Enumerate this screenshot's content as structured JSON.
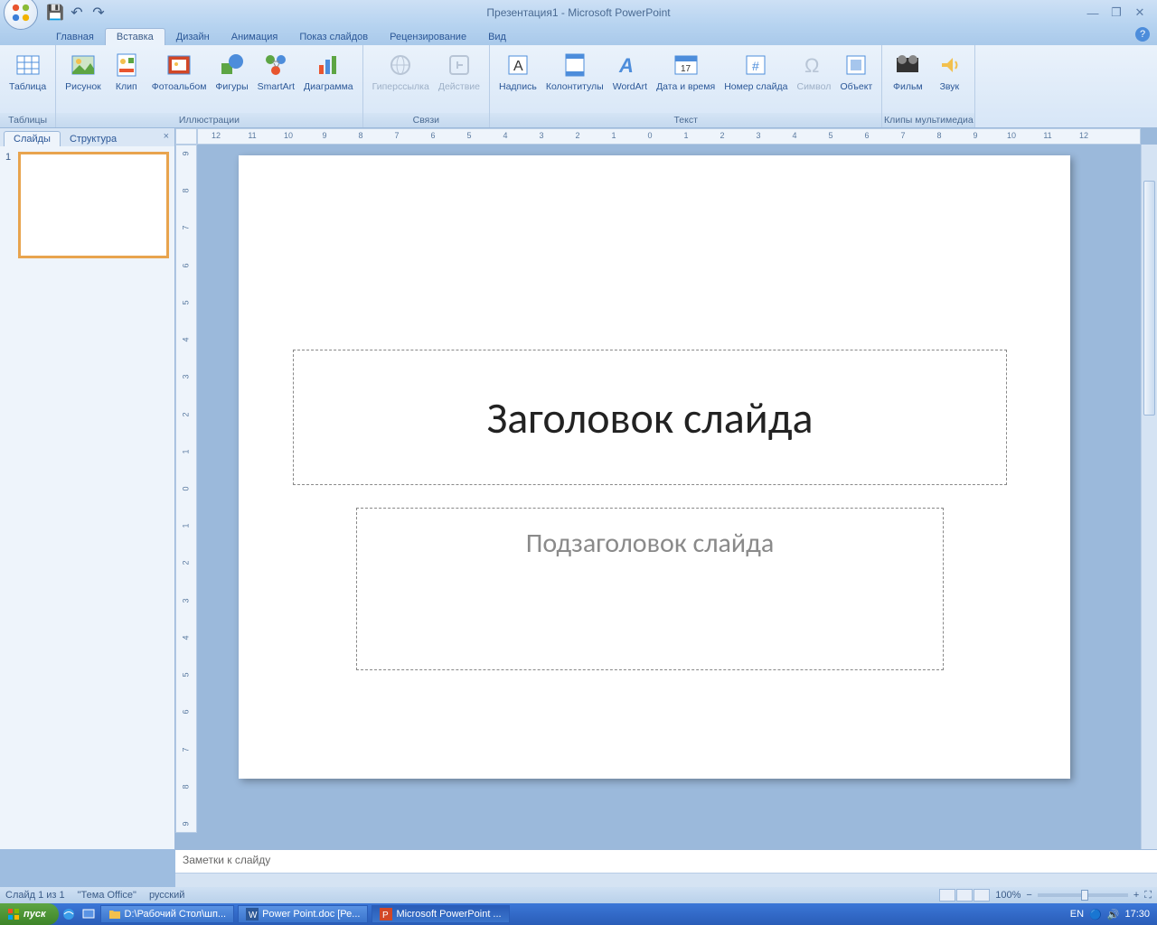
{
  "title": "Презентация1 - Microsoft PowerPoint",
  "qat": {
    "save": "💾",
    "undo": "↶",
    "redo": "↷"
  },
  "win": {
    "min": "—",
    "max": "❐",
    "close": "✕"
  },
  "tabs": [
    "Главная",
    "Вставка",
    "Дизайн",
    "Анимация",
    "Показ слайдов",
    "Рецензирование",
    "Вид"
  ],
  "active_tab": 1,
  "ribbon": {
    "groups": [
      {
        "label": "Таблицы",
        "items": [
          {
            "name": "Таблица",
            "icon": "table"
          }
        ]
      },
      {
        "label": "Иллюстрации",
        "items": [
          {
            "name": "Рисунок",
            "icon": "picture"
          },
          {
            "name": "Клип",
            "icon": "clip"
          },
          {
            "name": "Фотоальбом",
            "icon": "album"
          },
          {
            "name": "Фигуры",
            "icon": "shapes"
          },
          {
            "name": "SmartArt",
            "icon": "smartart"
          },
          {
            "name": "Диаграмма",
            "icon": "chart"
          }
        ]
      },
      {
        "label": "Связи",
        "items": [
          {
            "name": "Гиперссылка",
            "icon": "link",
            "disabled": true
          },
          {
            "name": "Действие",
            "icon": "action",
            "disabled": true
          }
        ]
      },
      {
        "label": "Текст",
        "items": [
          {
            "name": "Надпись",
            "icon": "textbox"
          },
          {
            "name": "Колонтитулы",
            "icon": "headerfooter"
          },
          {
            "name": "WordArt",
            "icon": "wordart"
          },
          {
            "name": "Дата и\nвремя",
            "icon": "datetime"
          },
          {
            "name": "Номер\nслайда",
            "icon": "slidenum"
          },
          {
            "name": "Символ",
            "icon": "symbol",
            "disabled": true
          },
          {
            "name": "Объект",
            "icon": "object"
          }
        ]
      },
      {
        "label": "Клипы мультимедиа",
        "items": [
          {
            "name": "Фильм",
            "icon": "movie"
          },
          {
            "name": "Звук",
            "icon": "sound"
          }
        ]
      }
    ]
  },
  "left_tabs": {
    "slides": "Слайды",
    "outline": "Структура"
  },
  "thumb_num": "1",
  "slide": {
    "title_placeholder": "Заголовок слайда",
    "subtitle_placeholder": "Подзаголовок слайда"
  },
  "notes_placeholder": "Заметки к слайду",
  "status": {
    "slide": "Слайд 1 из 1",
    "theme": "\"Тема Office\"",
    "lang": "русский",
    "zoom": "100%"
  },
  "zoom_controls": {
    "minus": "−",
    "plus": "+",
    "fit": "⛶"
  },
  "taskbar": {
    "start": "пуск",
    "items": [
      {
        "label": "D:\\Рабочий Стол\\шп...",
        "icon": "folder"
      },
      {
        "label": "Power Point.doc [Ре...",
        "icon": "word"
      },
      {
        "label": "Microsoft PowerPoint ...",
        "icon": "ppt",
        "active": true
      }
    ],
    "tray": {
      "lang": "EN",
      "time": "17:30"
    }
  },
  "ruler_h": [
    "12",
    "11",
    "10",
    "9",
    "8",
    "7",
    "6",
    "5",
    "4",
    "3",
    "2",
    "1",
    "0",
    "1",
    "2",
    "3",
    "4",
    "5",
    "6",
    "7",
    "8",
    "9",
    "10",
    "11",
    "12"
  ],
  "ruler_v": [
    "9",
    "8",
    "7",
    "6",
    "5",
    "4",
    "3",
    "2",
    "1",
    "0",
    "1",
    "2",
    "3",
    "4",
    "5",
    "6",
    "7",
    "8",
    "9"
  ]
}
